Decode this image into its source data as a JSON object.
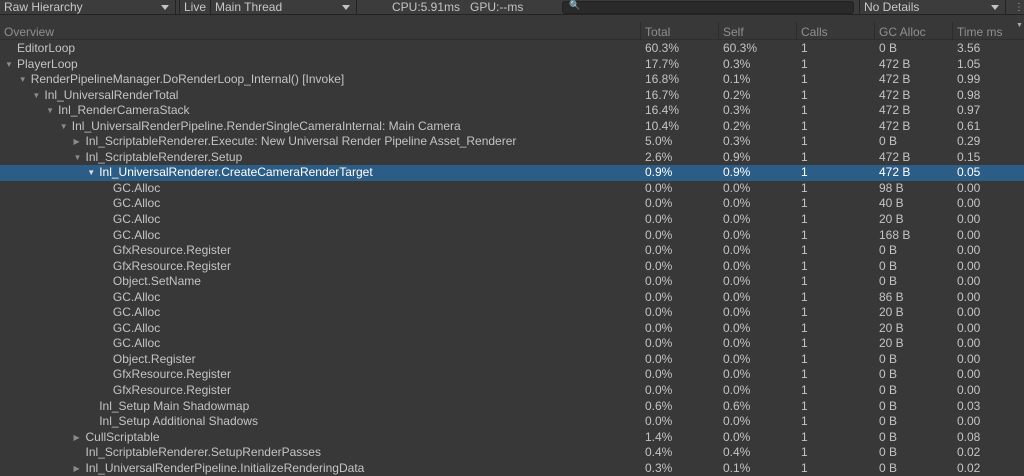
{
  "toolbar": {
    "view": "Raw Hierarchy",
    "live": "Live",
    "thread": "Main Thread",
    "cpu": "CPU:5.91ms",
    "gpu": "GPU:--ms",
    "search_placeholder": "",
    "details": "No Details"
  },
  "columns": [
    "Overview",
    "Total",
    "Self",
    "Calls",
    "GC Alloc",
    "Time ms"
  ],
  "rows": [
    {
      "name": "EditorLoop",
      "level": 0,
      "arrow": "",
      "total": "60.3%",
      "self": "60.3%",
      "calls": "1",
      "gc": "0 B",
      "time": "3.56"
    },
    {
      "name": "PlayerLoop",
      "level": 0,
      "arrow": "open",
      "total": "17.7%",
      "self": "0.3%",
      "calls": "1",
      "gc": "472 B",
      "time": "1.05"
    },
    {
      "name": "RenderPipelineManager.DoRenderLoop_Internal() [Invoke]",
      "level": 1,
      "arrow": "open",
      "total": "16.8%",
      "self": "0.1%",
      "calls": "1",
      "gc": "472 B",
      "time": "0.99"
    },
    {
      "name": "Inl_UniversalRenderTotal",
      "level": 2,
      "arrow": "open",
      "total": "16.7%",
      "self": "0.2%",
      "calls": "1",
      "gc": "472 B",
      "time": "0.98"
    },
    {
      "name": "Inl_RenderCameraStack",
      "level": 3,
      "arrow": "open",
      "total": "16.4%",
      "self": "0.3%",
      "calls": "1",
      "gc": "472 B",
      "time": "0.97"
    },
    {
      "name": "Inl_UniversalRenderPipeline.RenderSingleCameraInternal: Main Camera",
      "level": 4,
      "arrow": "open",
      "total": "10.4%",
      "self": "0.2%",
      "calls": "1",
      "gc": "472 B",
      "time": "0.61"
    },
    {
      "name": "Inl_ScriptableRenderer.Execute: New Universal Render Pipeline Asset_Renderer",
      "level": 5,
      "arrow": "closed",
      "total": "5.0%",
      "self": "0.3%",
      "calls": "1",
      "gc": "0 B",
      "time": "0.29"
    },
    {
      "name": "Inl_ScriptableRenderer.Setup",
      "level": 5,
      "arrow": "open",
      "total": "2.6%",
      "self": "0.9%",
      "calls": "1",
      "gc": "472 B",
      "time": "0.15"
    },
    {
      "name": "Inl_UniversalRenderer.CreateCameraRenderTarget",
      "level": 6,
      "arrow": "open",
      "selected": true,
      "total": "0.9%",
      "self": "0.9%",
      "calls": "1",
      "gc": "472 B",
      "time": "0.05"
    },
    {
      "name": "GC.Alloc",
      "level": 7,
      "arrow": "",
      "total": "0.0%",
      "self": "0.0%",
      "calls": "1",
      "gc": "98 B",
      "time": "0.00"
    },
    {
      "name": "GC.Alloc",
      "level": 7,
      "arrow": "",
      "total": "0.0%",
      "self": "0.0%",
      "calls": "1",
      "gc": "40 B",
      "time": "0.00"
    },
    {
      "name": "GC.Alloc",
      "level": 7,
      "arrow": "",
      "total": "0.0%",
      "self": "0.0%",
      "calls": "1",
      "gc": "20 B",
      "time": "0.00"
    },
    {
      "name": "GC.Alloc",
      "level": 7,
      "arrow": "",
      "total": "0.0%",
      "self": "0.0%",
      "calls": "1",
      "gc": "168 B",
      "time": "0.00"
    },
    {
      "name": "GfxResource.Register",
      "level": 7,
      "arrow": "",
      "total": "0.0%",
      "self": "0.0%",
      "calls": "1",
      "gc": "0 B",
      "time": "0.00"
    },
    {
      "name": "GfxResource.Register",
      "level": 7,
      "arrow": "",
      "total": "0.0%",
      "self": "0.0%",
      "calls": "1",
      "gc": "0 B",
      "time": "0.00"
    },
    {
      "name": "Object.SetName",
      "level": 7,
      "arrow": "",
      "total": "0.0%",
      "self": "0.0%",
      "calls": "1",
      "gc": "0 B",
      "time": "0.00"
    },
    {
      "name": "GC.Alloc",
      "level": 7,
      "arrow": "",
      "total": "0.0%",
      "self": "0.0%",
      "calls": "1",
      "gc": "86 B",
      "time": "0.00"
    },
    {
      "name": "GC.Alloc",
      "level": 7,
      "arrow": "",
      "total": "0.0%",
      "self": "0.0%",
      "calls": "1",
      "gc": "20 B",
      "time": "0.00"
    },
    {
      "name": "GC.Alloc",
      "level": 7,
      "arrow": "",
      "total": "0.0%",
      "self": "0.0%",
      "calls": "1",
      "gc": "20 B",
      "time": "0.00"
    },
    {
      "name": "GC.Alloc",
      "level": 7,
      "arrow": "",
      "total": "0.0%",
      "self": "0.0%",
      "calls": "1",
      "gc": "20 B",
      "time": "0.00"
    },
    {
      "name": "Object.Register",
      "level": 7,
      "arrow": "",
      "total": "0.0%",
      "self": "0.0%",
      "calls": "1",
      "gc": "0 B",
      "time": "0.00"
    },
    {
      "name": "GfxResource.Register",
      "level": 7,
      "arrow": "",
      "total": "0.0%",
      "self": "0.0%",
      "calls": "1",
      "gc": "0 B",
      "time": "0.00"
    },
    {
      "name": "GfxResource.Register",
      "level": 7,
      "arrow": "",
      "total": "0.0%",
      "self": "0.0%",
      "calls": "1",
      "gc": "0 B",
      "time": "0.00"
    },
    {
      "name": "Inl_Setup Main Shadowmap",
      "level": 6,
      "arrow": "",
      "total": "0.6%",
      "self": "0.6%",
      "calls": "1",
      "gc": "0 B",
      "time": "0.03"
    },
    {
      "name": "Inl_Setup Additional Shadows",
      "level": 6,
      "arrow": "",
      "total": "0.0%",
      "self": "0.0%",
      "calls": "1",
      "gc": "0 B",
      "time": "0.00"
    },
    {
      "name": "CullScriptable",
      "level": 5,
      "arrow": "closed",
      "total": "1.4%",
      "self": "0.0%",
      "calls": "1",
      "gc": "0 B",
      "time": "0.08"
    },
    {
      "name": "Inl_ScriptableRenderer.SetupRenderPasses",
      "level": 5,
      "arrow": "",
      "total": "0.4%",
      "self": "0.4%",
      "calls": "1",
      "gc": "0 B",
      "time": "0.02"
    },
    {
      "name": "Inl_UniversalRenderPipeline.InitializeRenderingData",
      "level": 5,
      "arrow": "closed",
      "total": "0.3%",
      "self": "0.1%",
      "calls": "1",
      "gc": "0 B",
      "time": "0.02"
    }
  ]
}
